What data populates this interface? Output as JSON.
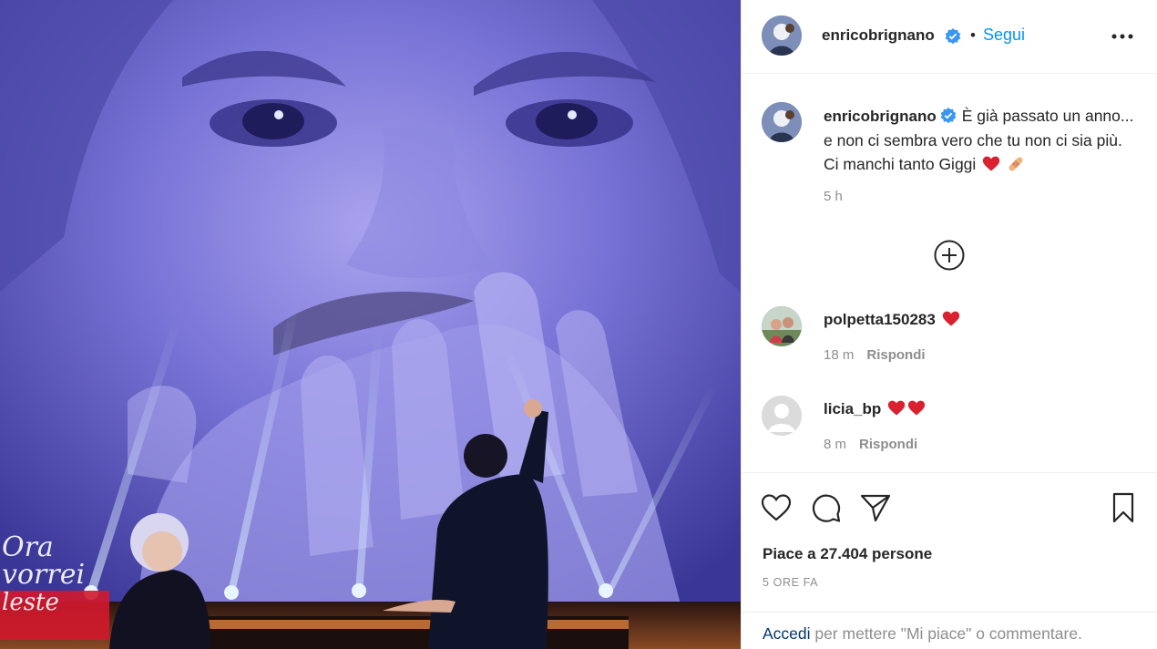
{
  "post": {
    "author": "enricobrignano",
    "follow_label": "Segui",
    "separator": "•",
    "caption": "È già passato un anno... e non ci sembra vero che tu non ci sia più. Ci manchi tanto Giggi",
    "caption_time": "5 h"
  },
  "comments": [
    {
      "user": "polpetta150283",
      "time": "18 m",
      "reply_label": "Rispondi",
      "emoji": [
        "red-heart"
      ]
    },
    {
      "user": "licia_bp",
      "time": "8 m",
      "reply_label": "Rispondi",
      "emoji": [
        "red-heart",
        "red-heart"
      ]
    }
  ],
  "stats": {
    "likes": "Piace a 27.404 persone",
    "date": "5 ORE FA"
  },
  "login": {
    "link": "Accedi",
    "text": "per mettere \"Mi piace\" o commentare."
  },
  "media": {
    "overlay_line1": "Ora",
    "overlay_line2": "vorrei",
    "overlay_line3": "leste"
  },
  "icons": {
    "verified": "verified-badge-icon",
    "more": "more-options-icon",
    "load_more": "plus-circle-icon",
    "like": "heart-outline-icon",
    "comment": "comment-bubble-icon",
    "share": "paper-plane-icon",
    "save": "bookmark-icon"
  },
  "colors": {
    "link_blue": "#0095f6",
    "heart_red": "#ed4956",
    "muted_text": "#8e8e8e"
  }
}
